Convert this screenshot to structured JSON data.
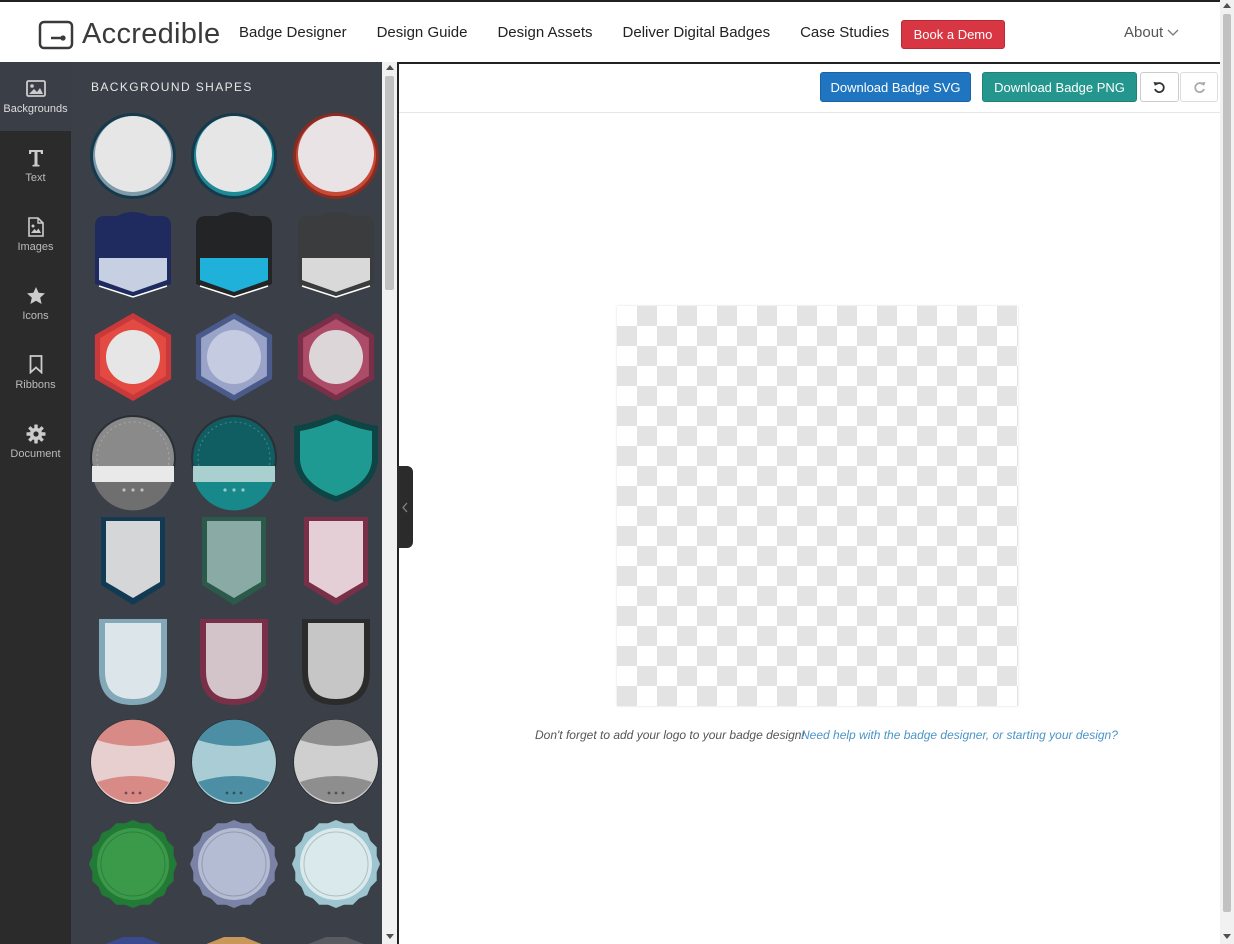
{
  "header": {
    "brand": "Accredible",
    "nav": [
      "Badge Designer",
      "Design Guide",
      "Design Assets",
      "Deliver Digital Badges",
      "Case Studies"
    ],
    "demo_button": "Book a Demo",
    "about": "About"
  },
  "sidebar": {
    "items": [
      {
        "label": "Backgrounds",
        "icon": "image-icon"
      },
      {
        "label": "Text",
        "icon": "text-icon"
      },
      {
        "label": "Images",
        "icon": "file-image-icon"
      },
      {
        "label": "Icons",
        "icon": "star-icon"
      },
      {
        "label": "Ribbons",
        "icon": "bookmark-icon"
      },
      {
        "label": "Document",
        "icon": "gear-icon"
      }
    ]
  },
  "panel": {
    "title": "BACKGROUND SHAPES",
    "shapes": [
      {
        "type": "circle",
        "colors": [
          "#163a4c",
          "#7f9aa8",
          "#e6e6e6"
        ]
      },
      {
        "type": "circle",
        "colors": [
          "#163a4c",
          "#1d8a96",
          "#e6e6e6"
        ]
      },
      {
        "type": "circle",
        "colors": [
          "#8b2a20",
          "#c64a35",
          "#e9e3e5"
        ]
      },
      {
        "type": "pennant",
        "colors": [
          "#1f2a5e",
          "#c7d0e2",
          "#ffffff"
        ]
      },
      {
        "type": "pennant",
        "colors": [
          "#222425",
          "#1fb1d9",
          "#ffffff"
        ]
      },
      {
        "type": "pennant",
        "colors": [
          "#3a3c3d",
          "#d9d9d9",
          "#ffffff"
        ]
      },
      {
        "type": "hexagon",
        "colors": [
          "#c9383a",
          "#e34b42",
          "#e6e6e6"
        ]
      },
      {
        "type": "hexagon",
        "colors": [
          "#4a5a8a",
          "#9aa4c8",
          "#c5cbe1"
        ]
      },
      {
        "type": "hexagon",
        "colors": [
          "#7a2f48",
          "#ad4c69",
          "#dcd6d9"
        ]
      },
      {
        "type": "circle-band",
        "colors": [
          "#8a8a8a",
          "#e9e9e9",
          "#6f6f6f"
        ]
      },
      {
        "type": "circle-band",
        "colors": [
          "#105d62",
          "#aacfcf",
          "#18898b"
        ]
      },
      {
        "type": "shield",
        "colors": [
          "#0e4444",
          "#1f9a93"
        ]
      },
      {
        "type": "banner",
        "colors": [
          "#123a52",
          "#d4d6d8"
        ]
      },
      {
        "type": "banner",
        "colors": [
          "#2b5a4a",
          "#8aaaa5"
        ]
      },
      {
        "type": "banner",
        "colors": [
          "#7a2f48",
          "#e4cfd6"
        ]
      },
      {
        "type": "arch",
        "colors": [
          "#83a9b9",
          "#dce6ea"
        ]
      },
      {
        "type": "arch",
        "colors": [
          "#7a2f48",
          "#d2c4c9"
        ]
      },
      {
        "type": "arch",
        "colors": [
          "#2b2b2b",
          "#c6c6c6"
        ]
      },
      {
        "type": "medallion",
        "colors": [
          "#d88a86",
          "#e8cfcf"
        ]
      },
      {
        "type": "medallion",
        "colors": [
          "#4c8fa4",
          "#a9ccd5"
        ]
      },
      {
        "type": "medallion",
        "colors": [
          "#8e8e8e",
          "#cfcfcf"
        ]
      },
      {
        "type": "octagon",
        "colors": [
          "#217a35",
          "#3a9a4a"
        ]
      },
      {
        "type": "octagon",
        "colors": [
          "#7a82a6",
          "#b4bcd4"
        ]
      },
      {
        "type": "octagon",
        "colors": [
          "#9ec6d0",
          "#dae9ec"
        ]
      }
    ]
  },
  "toolbar": {
    "download_svg": "Download Badge SVG",
    "download_png": "Download Badge PNG"
  },
  "canvas": {
    "hint": "Don't forget to add your logo to your badge design!",
    "help_link": "Need help with the badge designer, or starting your design?"
  }
}
